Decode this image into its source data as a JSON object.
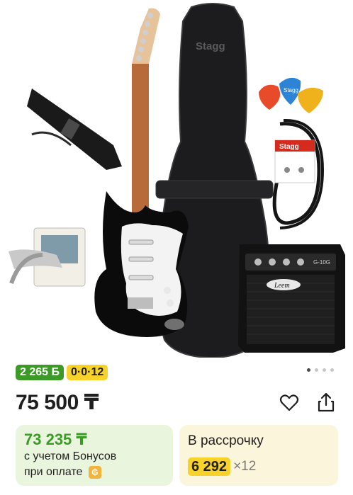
{
  "product_image": {
    "bag_brand": "Stagg",
    "amp_brand": "Leem",
    "amp_model": "G-10G",
    "cable_brand": "Stagg",
    "pick_brand": "Stagg"
  },
  "badges": {
    "bonus": "2 265 Б",
    "installment": "0·0·12"
  },
  "carousel": {
    "total": 4,
    "active": 1
  },
  "price": "75 500 ₸",
  "actions": {
    "favorite_icon": "heart-icon",
    "share_icon": "share-icon"
  },
  "bonus_card": {
    "price": "73 235 ₸",
    "line1": "с учетом Бонусов",
    "line2": "при оплате",
    "coin_symbol": "₲"
  },
  "credit_card": {
    "title": "В рассрочку",
    "amount": "6 292",
    "months": "×12"
  },
  "colors": {
    "green": "#3c9a26",
    "yellow": "#f7d22a",
    "bonus_bg": "#e9f5dd",
    "credit_bg": "#fbf5db"
  }
}
